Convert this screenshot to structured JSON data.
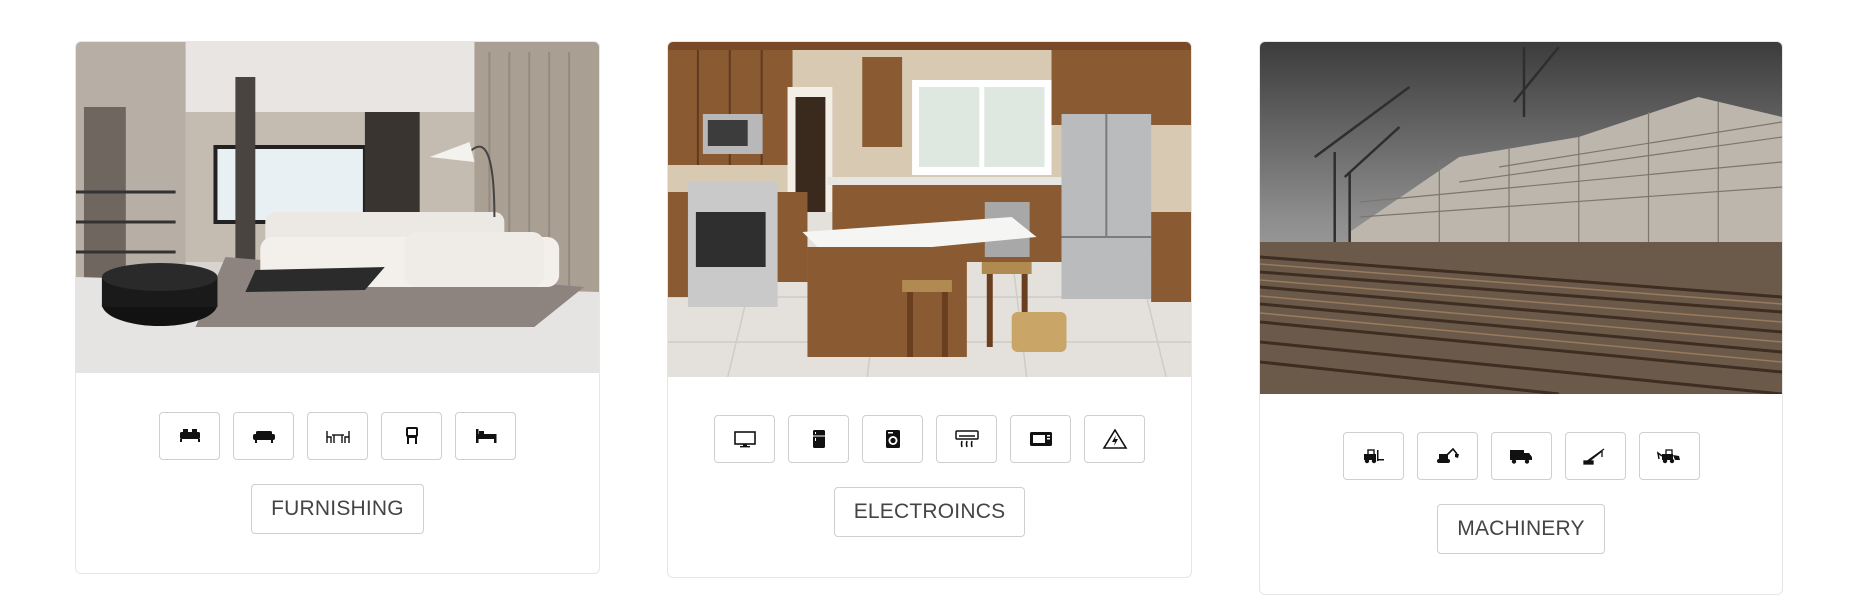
{
  "cards": [
    {
      "id": "furnishing",
      "category_label": "FURNISHING",
      "photo": "living-room-photo",
      "icons": [
        "double-bed-icon",
        "sofa-icon",
        "dining-table-icon",
        "chair-icon",
        "single-bed-icon"
      ]
    },
    {
      "id": "electronics",
      "category_label": "ELECTROINCS",
      "photo": "kitchen-appliances-photo",
      "icons": [
        "tv-icon",
        "refrigerator-icon",
        "washing-machine-icon",
        "air-conditioner-icon",
        "microwave-icon",
        "electrical-hazard-icon"
      ]
    },
    {
      "id": "machinery",
      "category_label": "MACHINERY",
      "photo": "construction-site-photo",
      "icons": [
        "forklift-icon",
        "excavator-icon",
        "truck-icon",
        "crane-icon",
        "backhoe-loader-icon"
      ]
    }
  ],
  "colors": {
    "card_border": "#e6e6e6",
    "button_border": "#cfcfcf",
    "text": "#444444"
  }
}
